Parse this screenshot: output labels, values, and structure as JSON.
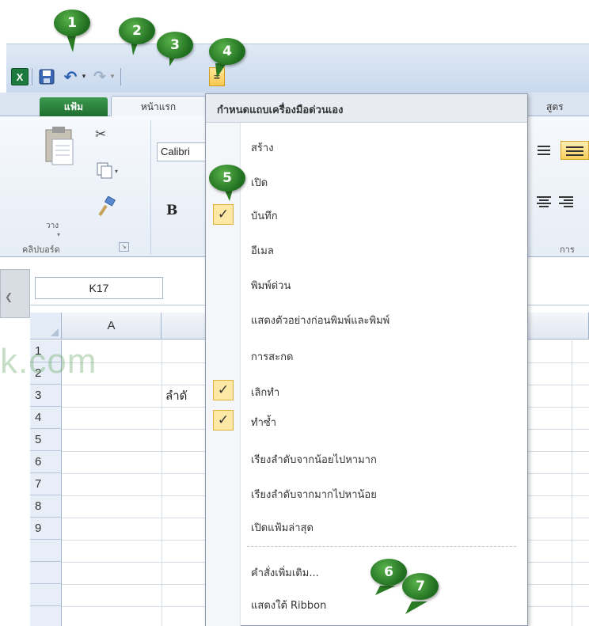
{
  "qat": {
    "excel_glyph": "X",
    "customize_glyph": "≡",
    "undo_dropdown_glyph": "▾",
    "redo_dropdown_glyph": "▾"
  },
  "tabs": {
    "file_label": "แฟ้ม",
    "home_label": "หน้าแรก",
    "formulas_label": "สูตร"
  },
  "ribbon": {
    "paste_label": "วาง",
    "font_name": "Calibri",
    "bold_label": "B",
    "clipboard_group_label": "คลิปบอร์ด",
    "number_group_label": "การ"
  },
  "formula_bar": {
    "name_box": "K17"
  },
  "grid": {
    "columns": [
      "A"
    ],
    "rows": [
      "1",
      "2",
      "3",
      "4",
      "5",
      "6",
      "7",
      "8",
      "9"
    ],
    "cell_b2": "ลำดั",
    "watermark": "k.com"
  },
  "menu": {
    "header": "กำหนดแถบเครื่องมือด่วนเอง",
    "items": [
      {
        "label": "สร้าง",
        "checked": false
      },
      {
        "label": "เปิด",
        "checked": false
      },
      {
        "label": "บันทึก",
        "checked": true
      },
      {
        "label": "อีเมล",
        "checked": false
      },
      {
        "label": "พิมพ์ด่วน",
        "checked": false
      },
      {
        "label": "แสดงตัวอย่างก่อนพิมพ์และพิมพ์",
        "checked": false
      },
      {
        "label": "การสะกด",
        "checked": false
      },
      {
        "label": "เลิกทำ",
        "checked": true
      },
      {
        "label": "ทำซ้ำ",
        "checked": true
      },
      {
        "label": "เรียงลำดับจากน้อยไปหามาก",
        "checked": false
      },
      {
        "label": "เรียงลำดับจากมากไปหาน้อย",
        "checked": false
      },
      {
        "label": "เปิดแฟ้มล่าสุด",
        "checked": false
      },
      {
        "label": "คำสั่งเพิ่มเติม...",
        "checked": false
      },
      {
        "label": "แสดงใต้ Ribbon",
        "checked": false
      }
    ],
    "check_glyph": "✓"
  },
  "callouts": [
    "1",
    "2",
    "3",
    "4",
    "5",
    "6",
    "7"
  ],
  "colors": {
    "file_tab": "#1f6e30",
    "check_highlight": "#fde8a6",
    "callout_green": "#2d8a2b"
  }
}
